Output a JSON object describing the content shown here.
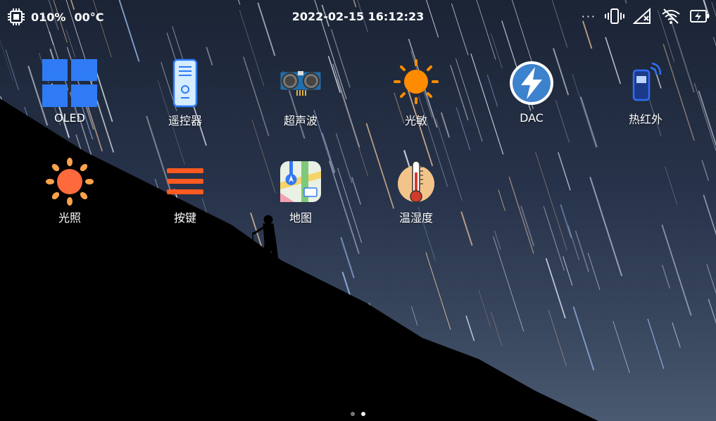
{
  "status_bar": {
    "cpu_usage": "010%",
    "temperature": "00°C",
    "datetime": "2022-02-15 16:12:23",
    "icons": [
      "cpu-icon",
      "more-dots-icon",
      "vibrate-icon",
      "no-signal-icon",
      "wifi-off-icon",
      "battery-charging-icon"
    ]
  },
  "apps": [
    {
      "id": "oled",
      "label": "OLED",
      "icon": "windows-grid-icon"
    },
    {
      "id": "remote",
      "label": "遥控器",
      "icon": "remote-control-icon"
    },
    {
      "id": "ultrasonic",
      "label": "超声波",
      "icon": "ultrasonic-sensor-icon"
    },
    {
      "id": "photosensitive",
      "label": "光敏",
      "icon": "sun-orange-icon"
    },
    {
      "id": "dac",
      "label": "DAC",
      "icon": "lightning-bolt-icon"
    },
    {
      "id": "infrared",
      "label": "热红外",
      "icon": "infrared-phone-icon"
    },
    {
      "id": "light",
      "label": "光照",
      "icon": "sun-icon"
    },
    {
      "id": "keys",
      "label": "按键",
      "icon": "menu-lines-icon"
    },
    {
      "id": "map",
      "label": "地图",
      "icon": "map-icon"
    },
    {
      "id": "humiture",
      "label": "温湿度",
      "icon": "thermometer-icon"
    }
  ],
  "pager": {
    "pages": 2,
    "current": 2
  },
  "colors": {
    "accent_blue": "#2f7bf5",
    "sun_orange": "#ff8c00",
    "sun_coral": "#ff6a3d",
    "menu_orange": "#ff5a1f"
  }
}
